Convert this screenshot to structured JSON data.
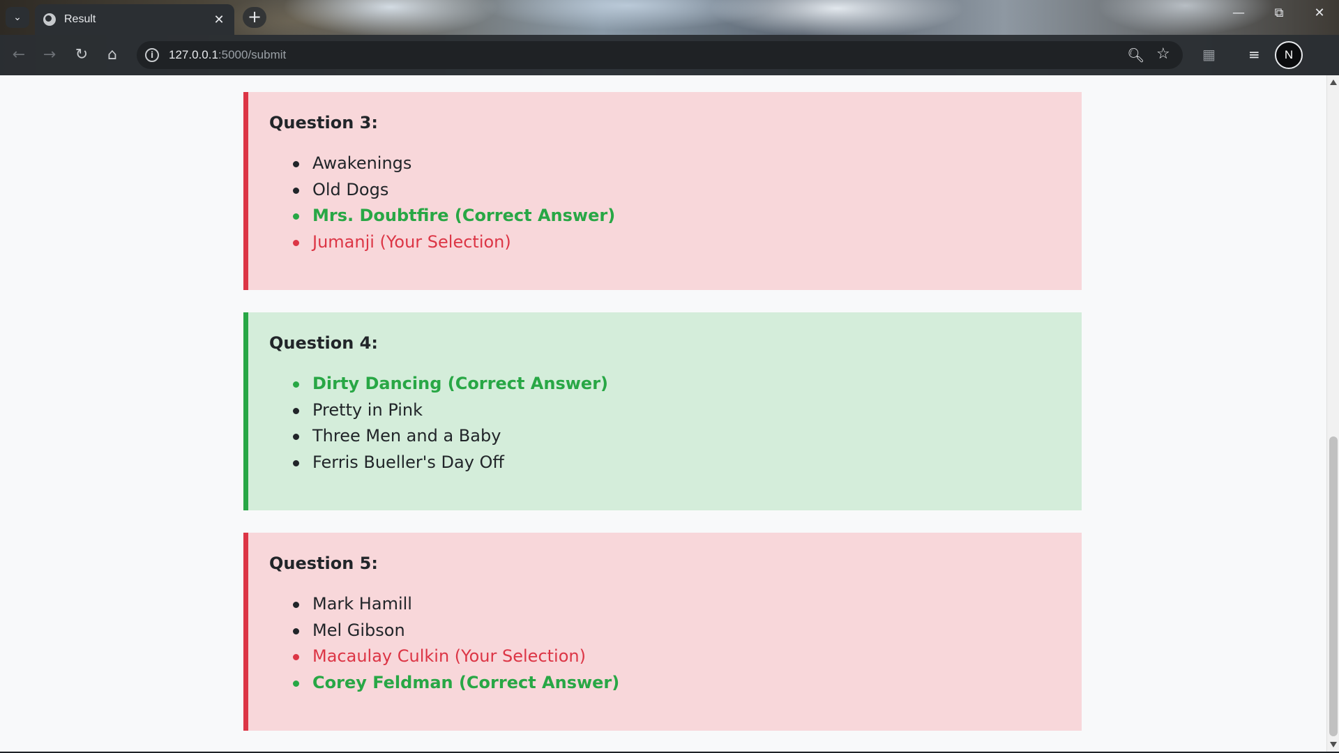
{
  "browser": {
    "tab_title": "Result",
    "url_host": "127.0.0.1",
    "url_path": ":5000/submit",
    "profile_initial": "N"
  },
  "colors": {
    "incorrect_bg": "#f8d7da",
    "incorrect_accent": "#dc3545",
    "correct_bg": "#d4edda",
    "correct_accent": "#28a745"
  },
  "questions": [
    {
      "title": "Question 3:",
      "status": "incorrect",
      "options": [
        {
          "text": "Awakenings",
          "state": "normal"
        },
        {
          "text": "Old Dogs",
          "state": "normal"
        },
        {
          "text": "Mrs. Doubtfire (Correct Answer)",
          "state": "correct"
        },
        {
          "text": "Jumanji (Your Selection)",
          "state": "selected"
        }
      ]
    },
    {
      "title": "Question 4:",
      "status": "correct",
      "options": [
        {
          "text": "Dirty Dancing (Correct Answer)",
          "state": "correct"
        },
        {
          "text": "Pretty in Pink",
          "state": "normal"
        },
        {
          "text": "Three Men and a Baby",
          "state": "normal"
        },
        {
          "text": "Ferris Bueller's Day Off",
          "state": "normal"
        }
      ]
    },
    {
      "title": "Question 5:",
      "status": "incorrect",
      "options": [
        {
          "text": "Mark Hamill",
          "state": "normal"
        },
        {
          "text": "Mel Gibson",
          "state": "normal"
        },
        {
          "text": "Macaulay Culkin (Your Selection)",
          "state": "selected"
        },
        {
          "text": "Corey Feldman (Correct Answer)",
          "state": "correct"
        }
      ]
    }
  ]
}
